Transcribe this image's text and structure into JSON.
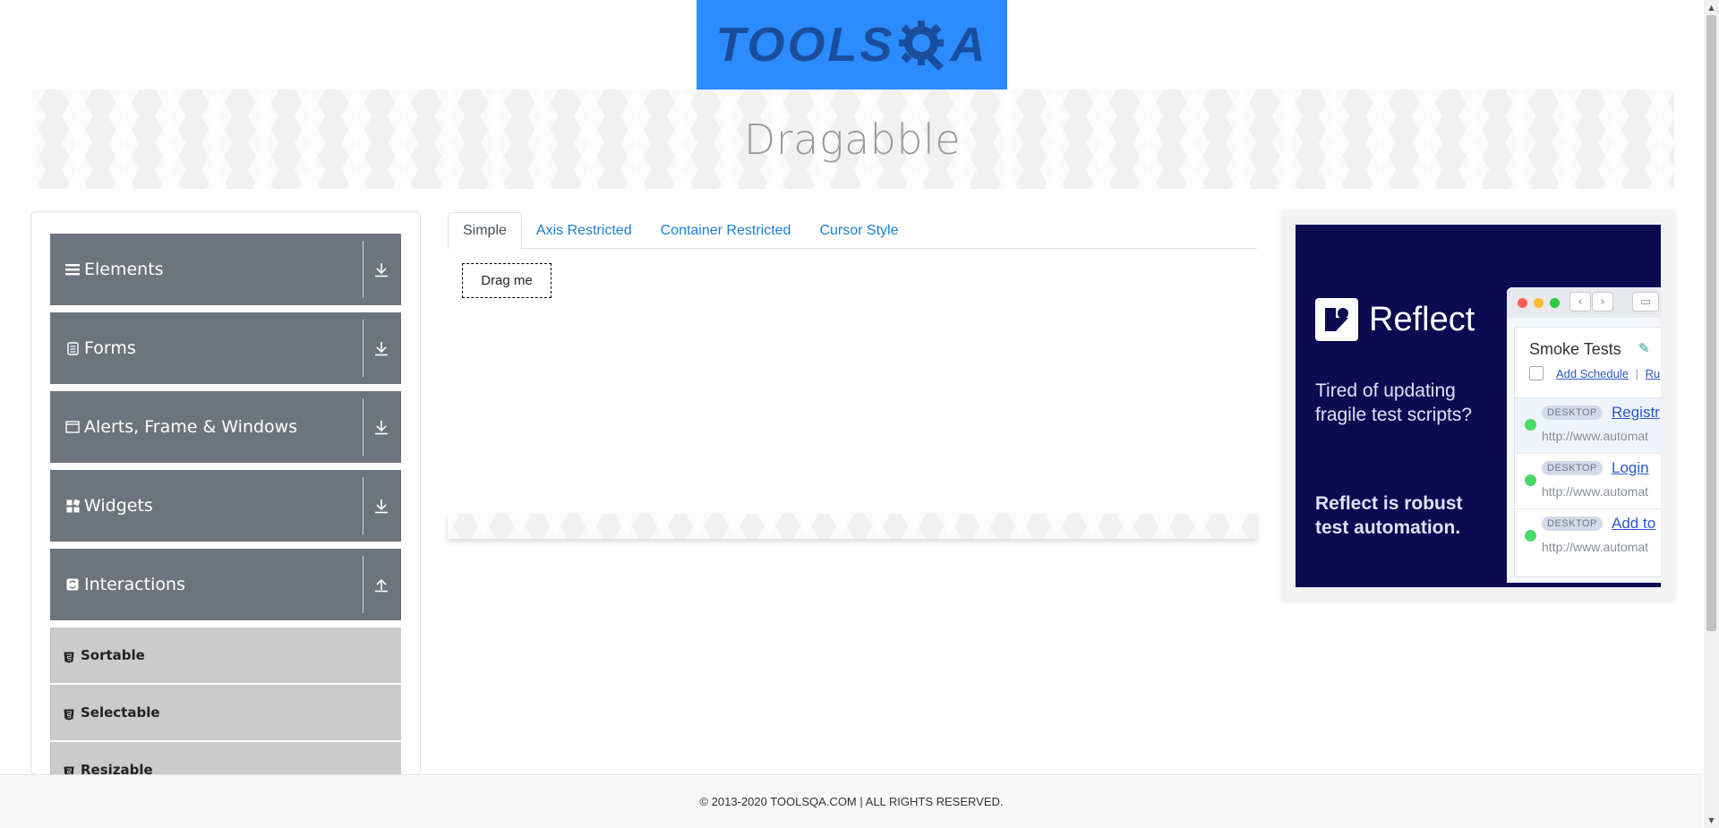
{
  "logo": {
    "text_left": "TOOLS",
    "text_right": "A",
    "bg_color": "#2c8cff"
  },
  "banner": {
    "title": "Dragabble"
  },
  "sidebar": {
    "groups": [
      {
        "label": "Elements",
        "icon": "menu-icon",
        "expanded": false
      },
      {
        "label": "Forms",
        "icon": "form-icon",
        "expanded": false
      },
      {
        "label": "Alerts, Frame & Windows",
        "icon": "window-icon",
        "expanded": false
      },
      {
        "label": "Widgets",
        "icon": "widgets-icon",
        "expanded": false
      },
      {
        "label": "Interactions",
        "icon": "interactions-icon",
        "expanded": true
      }
    ],
    "interaction_items": [
      {
        "label": "Sortable"
      },
      {
        "label": "Selectable"
      },
      {
        "label": "Resizable"
      }
    ]
  },
  "tabs": [
    {
      "label": "Simple",
      "active": true
    },
    {
      "label": "Axis Restricted",
      "active": false
    },
    {
      "label": "Container Restricted",
      "active": false
    },
    {
      "label": "Cursor Style",
      "active": false
    }
  ],
  "drag_box": {
    "label": "Drag me"
  },
  "ad": {
    "brand": "Reflect",
    "copy1": "Tired of updating fragile test scripts?",
    "copy2": "Reflect is robust test automation.",
    "window_title": "Smoke Tests",
    "links": [
      "Add Schedule",
      "|",
      "Ru"
    ],
    "rows": [
      {
        "tag": "DESKTOP",
        "link": "Registr",
        "url": "http://www.automat"
      },
      {
        "tag": "DESKTOP",
        "link": "Login",
        "url": "http://www.automat"
      },
      {
        "tag": "DESKTOP",
        "link": "Add to",
        "url": "http://www.automat"
      }
    ],
    "bg_color": "#0b0b52"
  },
  "footer": {
    "text": "© 2013-2020 TOOLSQA.COM | ALL RIGHTS RESERVED."
  },
  "colors": {
    "sidebar_header": "#6c757d",
    "sidebar_sub": "#cbcbcb",
    "tab_link": "#1c7ed6"
  }
}
